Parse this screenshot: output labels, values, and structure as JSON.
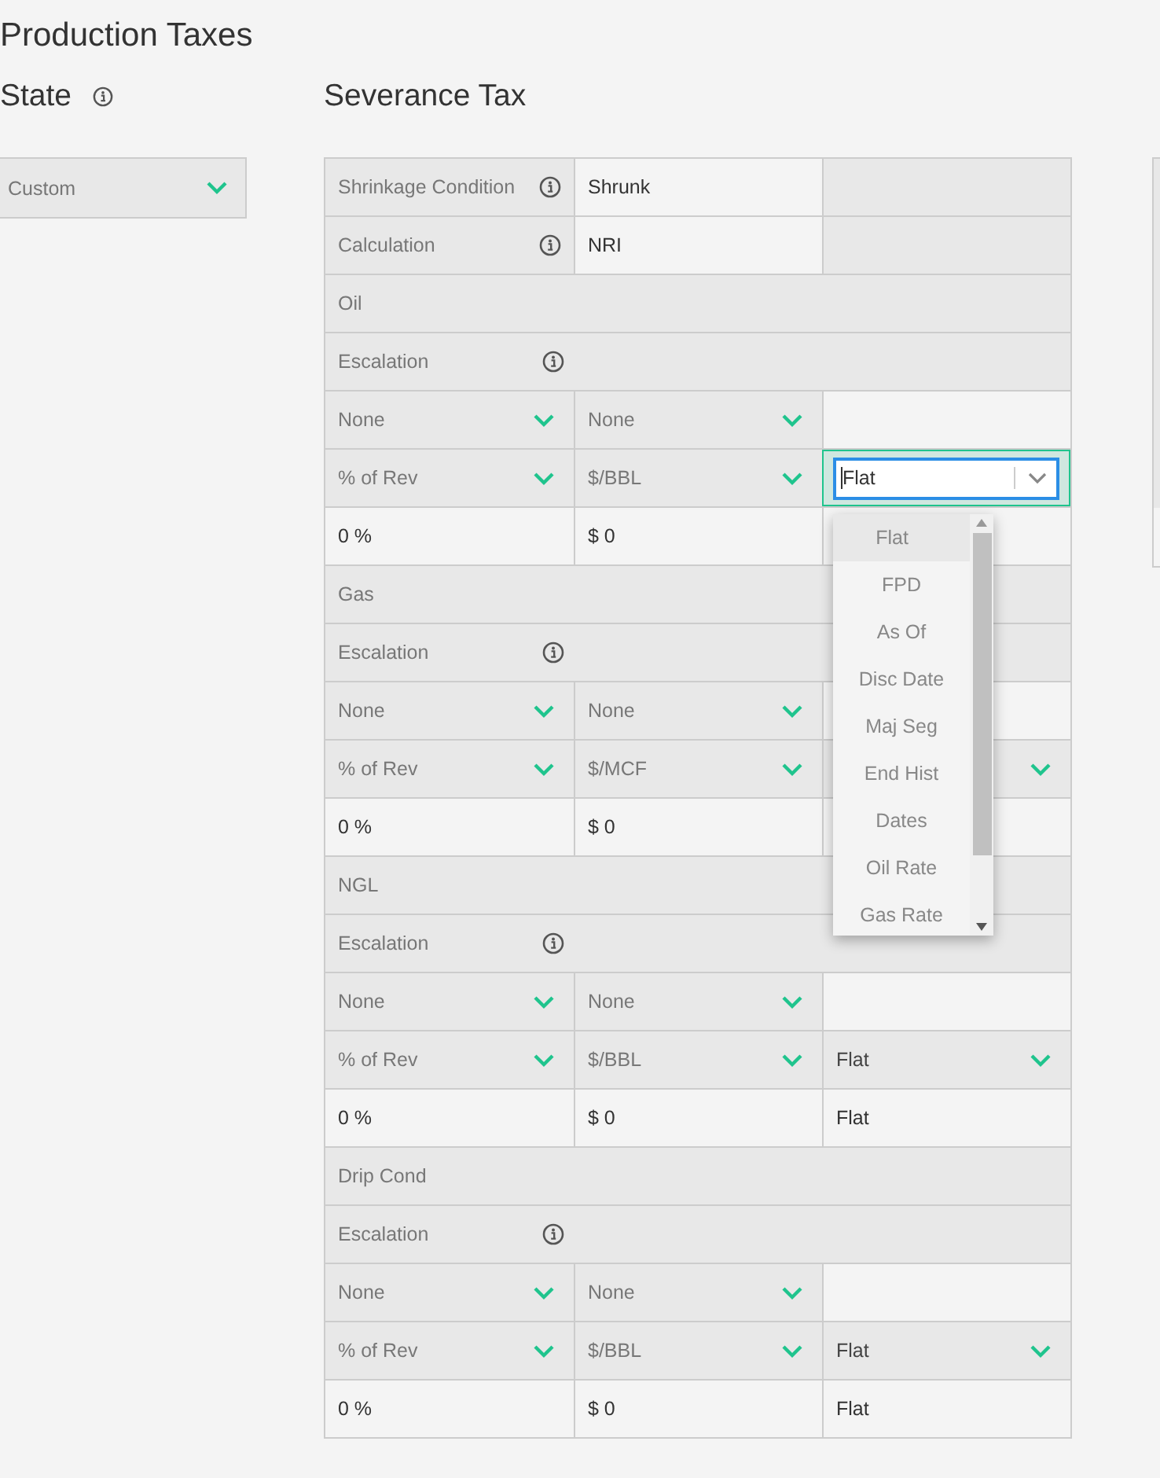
{
  "title": "Production Taxes",
  "state": {
    "heading": "State",
    "info": true,
    "select": {
      "value": "Custom"
    }
  },
  "severance": {
    "heading": "Severance Tax",
    "rows": [
      {
        "kind": "field",
        "label": "Shrinkage Condition",
        "info": true,
        "value": "Shrunk"
      },
      {
        "kind": "field",
        "label": "Calculation",
        "info": true,
        "value": "NRI"
      },
      {
        "kind": "heading",
        "label": "Oil",
        "info": false
      },
      {
        "kind": "heading",
        "label": "Escalation",
        "info": true
      },
      {
        "kind": "cells",
        "cells": [
          {
            "kind": "select",
            "value": "None"
          },
          {
            "kind": "select",
            "value": "None"
          },
          {
            "kind": "blank"
          }
        ]
      },
      {
        "kind": "cells",
        "cells": [
          {
            "kind": "select",
            "value": "% of Rev"
          },
          {
            "kind": "select",
            "value": "$/BBL"
          },
          {
            "kind": "combo",
            "value": "Flat",
            "focused": true,
            "dropdown": {
              "options": [
                {
                  "label": "Flat",
                  "selected": true
                },
                {
                  "label": "FPD",
                  "selected": false
                },
                {
                  "label": "As Of",
                  "selected": false
                },
                {
                  "label": "Disc Date",
                  "selected": false
                },
                {
                  "label": "Maj Seg",
                  "selected": false
                },
                {
                  "label": "End Hist",
                  "selected": false
                },
                {
                  "label": "Dates",
                  "selected": false
                },
                {
                  "label": "Oil Rate",
                  "selected": false
                },
                {
                  "label": "Gas Rate",
                  "selected": false
                }
              ]
            }
          }
        ]
      },
      {
        "kind": "cells",
        "cells": [
          {
            "kind": "text",
            "value": "0 %"
          },
          {
            "kind": "text",
            "value": "$ 0"
          },
          {
            "kind": "blank"
          }
        ]
      },
      {
        "kind": "heading",
        "label": "Gas",
        "info": false
      },
      {
        "kind": "heading",
        "label": "Escalation",
        "info": true
      },
      {
        "kind": "cells",
        "cells": [
          {
            "kind": "select",
            "value": "None"
          },
          {
            "kind": "select",
            "value": "None"
          },
          {
            "kind": "blank"
          }
        ]
      },
      {
        "kind": "cells",
        "cells": [
          {
            "kind": "select",
            "value": "% of Rev"
          },
          {
            "kind": "select",
            "value": "$/MCF"
          },
          {
            "kind": "select"
          }
        ]
      },
      {
        "kind": "cells",
        "cells": [
          {
            "kind": "text",
            "value": "0 %"
          },
          {
            "kind": "text",
            "value": "$ 0"
          },
          {
            "kind": "blank"
          }
        ]
      },
      {
        "kind": "heading",
        "label": "NGL",
        "info": false
      },
      {
        "kind": "heading",
        "label": "Escalation",
        "info": true
      },
      {
        "kind": "cells",
        "cells": [
          {
            "kind": "select",
            "value": "None"
          },
          {
            "kind": "select",
            "value": "None"
          },
          {
            "kind": "blank"
          }
        ]
      },
      {
        "kind": "cells",
        "cells": [
          {
            "kind": "select",
            "value": "% of Rev"
          },
          {
            "kind": "select",
            "value": "$/BBL"
          },
          {
            "kind": "select",
            "value": "Flat"
          }
        ]
      },
      {
        "kind": "cells",
        "cells": [
          {
            "kind": "text",
            "value": "0 %"
          },
          {
            "kind": "text",
            "value": "$ 0"
          },
          {
            "kind": "text",
            "value": "Flat"
          }
        ]
      },
      {
        "kind": "heading",
        "label": "Drip Cond",
        "info": false
      },
      {
        "kind": "heading",
        "label": "Escalation",
        "info": true
      },
      {
        "kind": "cells",
        "cells": [
          {
            "kind": "select",
            "value": "None"
          },
          {
            "kind": "select",
            "value": "None"
          },
          {
            "kind": "blank"
          }
        ]
      },
      {
        "kind": "cells",
        "cells": [
          {
            "kind": "select",
            "value": "% of Rev"
          },
          {
            "kind": "select",
            "value": "$/BBL"
          },
          {
            "kind": "select",
            "value": "Flat"
          }
        ]
      },
      {
        "kind": "cells",
        "cells": [
          {
            "kind": "text",
            "value": "0 %"
          },
          {
            "kind": "text",
            "value": "$ 0"
          },
          {
            "kind": "text",
            "value": "Flat"
          }
        ]
      }
    ]
  }
}
